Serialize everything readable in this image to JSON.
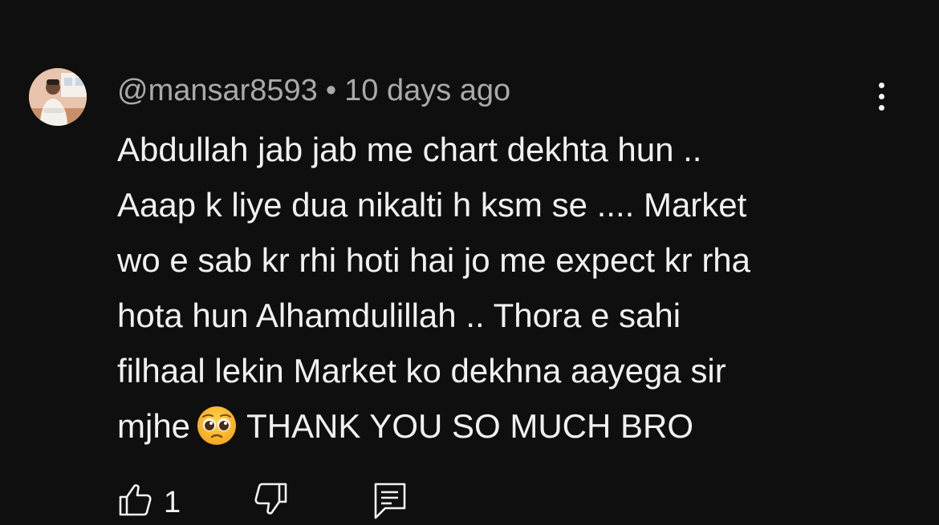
{
  "comment": {
    "author": "@mansar8593",
    "separator": "•",
    "time_ago": "10 days ago",
    "lines": [
      "Abdullah jab jab me chart dekhta hun ..",
      "Aaap k liye dua nikalti h ksm se .... Market",
      "wo e sab kr rhi hoti hai jo me expect kr rha",
      "hota hun Alhamdulillah .. Thora e sahi",
      "filhaal lekin Market ko dekhna  aayega sir"
    ],
    "last_line_before_emoji": "mjhe",
    "emoji": "pleading-face-emoji",
    "last_line_after_emoji": "THANK YOU SO MUCH BRO",
    "like_count": "1"
  },
  "icons": {
    "avatar": "avatar",
    "more": "more-vert-icon",
    "like": "thumb-up-icon",
    "dislike": "thumb-down-icon",
    "reply": "reply-comment-icon"
  },
  "colors": {
    "background": "#0f0f0f",
    "text_primary": "#f1f1f1",
    "text_secondary": "#aaaaaa"
  }
}
